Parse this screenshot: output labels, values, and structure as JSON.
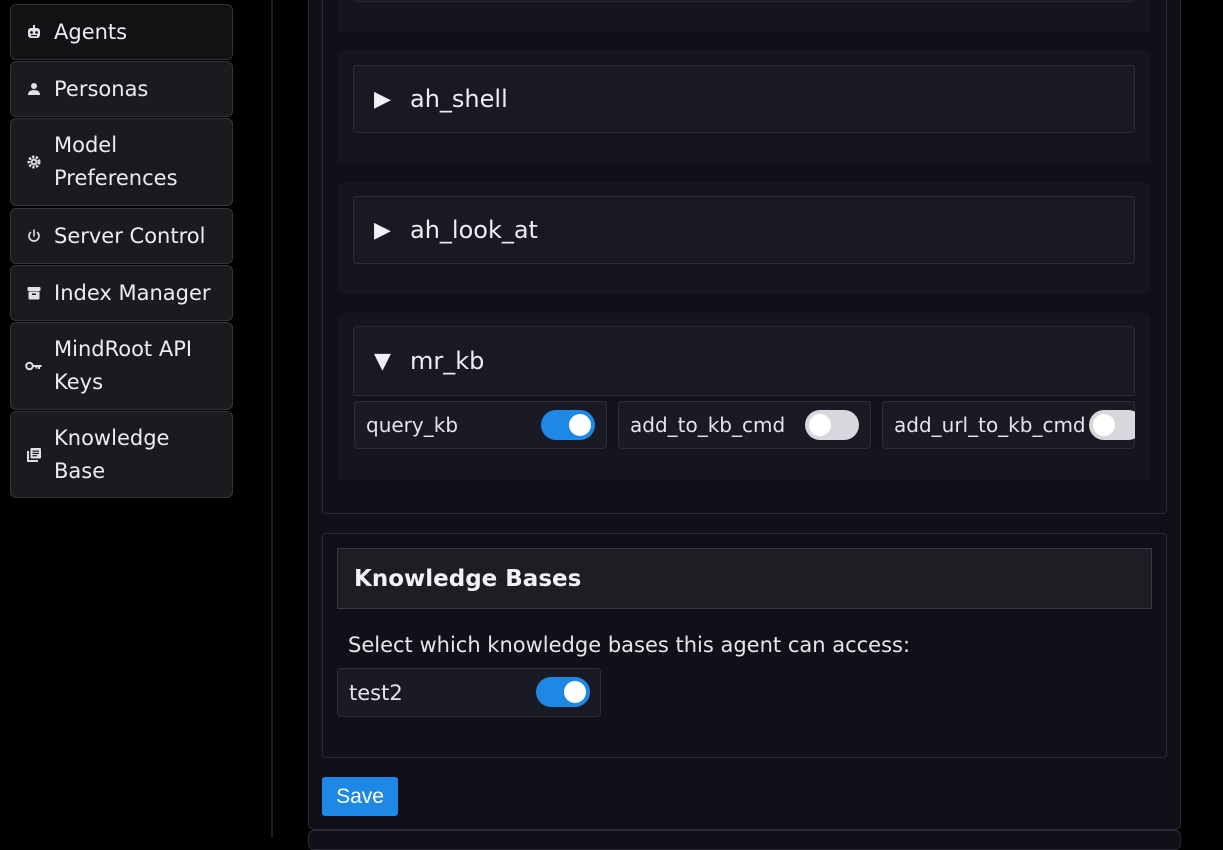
{
  "sidebar": {
    "items": [
      {
        "label": "Agents",
        "icon": "robot-icon"
      },
      {
        "label": "Personas",
        "icon": "person-icon"
      },
      {
        "label": "Model Preferences",
        "icon": "gear-icon"
      },
      {
        "label": "Server Control",
        "icon": "power-icon"
      },
      {
        "label": "Index Manager",
        "icon": "archive-icon"
      },
      {
        "label": "MindRoot API Keys",
        "icon": "key-icon"
      },
      {
        "label": "Knowledge Base",
        "icon": "library-books-icon"
      }
    ]
  },
  "commands": {
    "plugins": [
      {
        "name": "ah_shell",
        "expanded": false,
        "arrow": "▶"
      },
      {
        "name": "ah_look_at",
        "expanded": false,
        "arrow": "▶"
      },
      {
        "name": "mr_kb",
        "expanded": true,
        "arrow": "▼",
        "commands": [
          {
            "name": "query_kb",
            "enabled": true
          },
          {
            "name": "add_to_kb_cmd",
            "enabled": false
          },
          {
            "name": "add_url_to_kb_cmd",
            "enabled": false
          }
        ]
      }
    ]
  },
  "knowledge_bases": {
    "title": "Knowledge Bases",
    "description": "Select which knowledge bases this agent can access:",
    "items": [
      {
        "name": "test2",
        "enabled": true
      }
    ]
  },
  "actions": {
    "save_label": "Save"
  },
  "colors": {
    "accent": "#1e88e5",
    "toggle_off": "#d8d8dc",
    "background": "#000000",
    "panel": "#101018"
  }
}
